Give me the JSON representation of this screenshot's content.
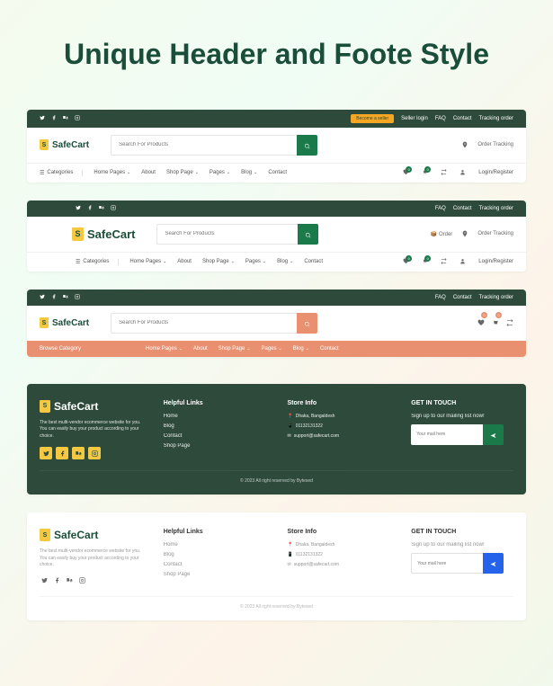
{
  "title": "Unique Header and Foote Style",
  "brand": "SafeCart",
  "search": {
    "placeholder": "Search For Products"
  },
  "topbar": {
    "sellerBtn": "Become a seller",
    "sellerLogin": "Seller login",
    "faq": "FAQ",
    "contact": "Contact",
    "tracking": "Tracking order"
  },
  "nav": {
    "categories": "Categories",
    "homePages": "Home Pages",
    "about": "About",
    "shopPage": "Shop Page",
    "pages": "Pages",
    "blog": "Blog",
    "contact": "Contact",
    "browseCat": "Browse Category"
  },
  "actions": {
    "orderTracking": "Order Tracking",
    "order": "Order",
    "loginRegister": "Login/Register",
    "badgeCount": "0"
  },
  "footer": {
    "desc": "The best multi-vendor ecommerce website for you. You can easily buy your product according to your choice.",
    "helpfulTitle": "Helpful Links",
    "links": {
      "home": "Home",
      "blog": "Blog",
      "contact": "Contact",
      "shopPage": "Shop Page"
    },
    "storeTitle": "Store Info",
    "store": {
      "address": "Dhaka, Bangaldesh",
      "phone": "01132131322",
      "email": "support@safecart.com"
    },
    "touchTitle": "GET IN TOUCH",
    "touchDesc": "Sign up to our mailing list now!",
    "mailPlaceholder": "Your mail here",
    "copyright": "© 2023 All right reserved by Bytesed"
  }
}
